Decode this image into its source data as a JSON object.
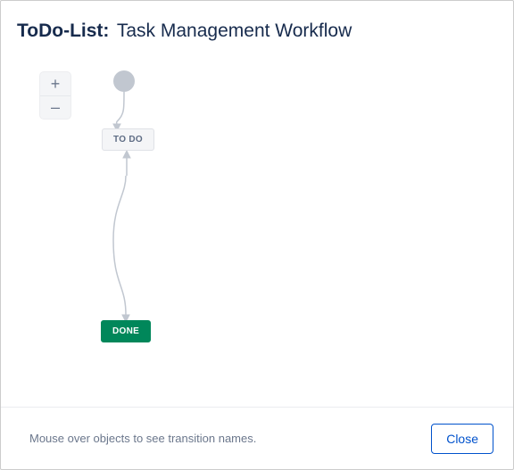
{
  "header": {
    "prefix": "ToDo-List:",
    "title": "Task Management Workflow"
  },
  "zoom": {
    "in_label": "+",
    "out_label": "–"
  },
  "workflow": {
    "start_label": "",
    "status_todo": "TO DO",
    "status_done": "DONE"
  },
  "footer": {
    "hint": "Mouse over objects to see transition names.",
    "close_label": "Close"
  },
  "colors": {
    "done_bg": "#00875a",
    "todo_bg": "#f4f5f7",
    "edge": "#c1c7d0",
    "primary": "#0052cc"
  }
}
